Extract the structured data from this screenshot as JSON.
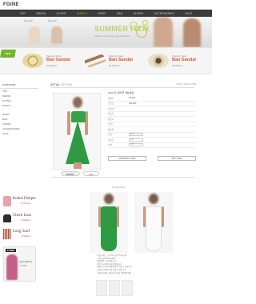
{
  "logo": "FGINE",
  "nav": [
    "TOP",
    "DRESS",
    "OUTER",
    "SHIRTS",
    "SKIRT",
    "BAG",
    "SHOES",
    "ACCESSORIES",
    "SALE"
  ],
  "nav_active_index": 3,
  "banner": {
    "title": "SUMMER ITEM",
    "subtitle": "Fashion trend new style collection",
    "left_labels": [
      "New shirt",
      "New shirt"
    ]
  },
  "new_badge": "NEW",
  "products": [
    {
      "brand": "Peacock Sand",
      "name": "Ban Sandal",
      "price": "35,000won"
    },
    {
      "brand": "Peacock Sand",
      "name": "Ban Sandal",
      "price": "35,000won"
    },
    {
      "brand": "Peacock Sand",
      "name": "Ban Sandal",
      "price": "35,000won"
    }
  ],
  "sidebar": {
    "category_header": "CATEGORY",
    "categories": [
      "TOP",
      "DRESS",
      "OUTER",
      "PANTS"
    ],
    "sub_categories": [
      "SKIRT",
      "BAG",
      "SHOES",
      "ACCESSORIES",
      "SALE"
    ],
    "side_products": [
      {
        "name": "Rolled Pinkpie",
        "price": "70,000won"
      },
      {
        "name": "Check Laux",
        "price": "70,000won"
      },
      {
        "name": "Long Scarf",
        "price": "70,000won"
      }
    ],
    "promo": {
      "logo": "FGINE",
      "text": "Color Skinny",
      "price": "\\ 47,000"
    }
  },
  "detail": {
    "heading": "DETAIL",
    "heading_sub": "REVIEW",
    "breadcrumb": "HOME > DETAIL VIEW",
    "title": "2010 한 미래 풀 미팅처럼",
    "rows": [
      {
        "label": "판매가",
        "value": "25,000"
      },
      {
        "label": "적립금",
        "value": "250,000"
      },
      {
        "label": "상품코드",
        "value": ""
      },
      {
        "label": "제조사",
        "value": ""
      },
      {
        "label": "원산지",
        "value": ""
      },
      {
        "label": "브랜드",
        "value": ""
      },
      {
        "label": "배송비",
        "value": ""
      },
      {
        "label": "색상",
        "value": ""
      },
      {
        "label": "사이즈",
        "value": ""
      },
      {
        "label": "수량",
        "value": ""
      }
    ],
    "select_placeholder": "선택",
    "btn_cart": "SHOPPING CART",
    "btn_buy": "BUY NOW"
  },
  "tabs": [
    "DETAIL",
    "Q&A"
  ],
  "detail_caption": "Product Detail",
  "desc_lines": [
    "- 모델 사이즈: 키 170 가슴 32 허리 25",
    "- 소재: COTTON 100%",
    "- 세탁방법: 드라이클리닝",
    "- 주문 후 2~3일 이내 발송됩니다",
    "- 색상은 모니터 환경에 따라 다를 수 있습니다",
    "- 교환 및 반품은 7일 이내 가능합니다",
    "- 자세한 문의는 Q&A 게시판을 이용해주세요"
  ],
  "colors": {
    "accent_green": "#9ccc2b",
    "dress_green": "#2f9a44",
    "price_orange": "#e0542e",
    "nav_dark": "#3b3b3b"
  }
}
